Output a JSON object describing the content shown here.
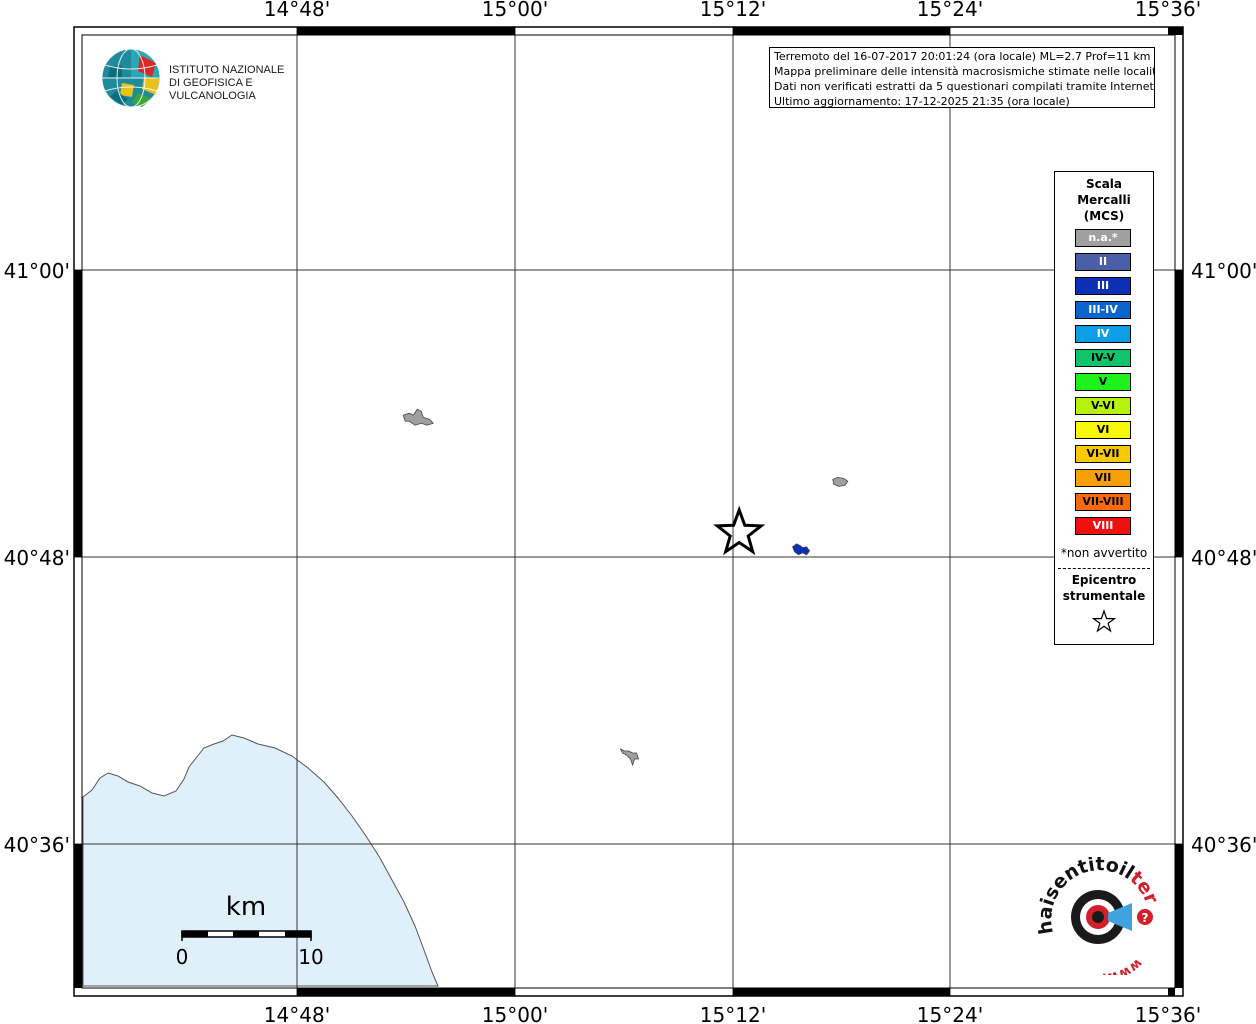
{
  "info": {
    "line1": "Terremoto del 16-07-2017 20:01:24 (ora locale) ML=2.7 Prof=11 km",
    "line2": "Mappa preliminare delle intensità macrosismiche stimate nelle località",
    "line3": "Dati non verificati estratti da 5 questionari compilati tramite Internet.",
    "line4": "Ultimo aggiornamento: 17-12-2025 21:35 (ora locale)"
  },
  "ingv_logo": {
    "line1": "ISTITUTO NAZIONALE",
    "line2": "DI GEOFISICA E VULCANOLOGIA"
  },
  "axes": {
    "lon_labels": [
      "14°48'",
      "15°00'",
      "15°12'",
      "15°24'",
      "15°36'"
    ],
    "lat_labels": [
      "41°00'",
      "40°48'",
      "40°36'"
    ]
  },
  "legend": {
    "title1": "Scala",
    "title2": "Mercalli",
    "title3": "(MCS)",
    "items": [
      {
        "label": "n.a.*",
        "color": "#a0a0a0",
        "text_color": "#ffffff"
      },
      {
        "label": "II",
        "color": "#4a5fa8",
        "text_color": "#ffffff"
      },
      {
        "label": "III",
        "color": "#0b2fb5",
        "text_color": "#ffffff"
      },
      {
        "label": "III-IV",
        "color": "#0a66cc",
        "text_color": "#ffffff"
      },
      {
        "label": "IV",
        "color": "#0e9ee8",
        "text_color": "#ffffff"
      },
      {
        "label": "IV-V",
        "color": "#10c46c",
        "text_color": "#000000"
      },
      {
        "label": "V",
        "color": "#1df21d",
        "text_color": "#000000"
      },
      {
        "label": "V-VI",
        "color": "#b6f20e",
        "text_color": "#000000"
      },
      {
        "label": "VI",
        "color": "#f8f80a",
        "text_color": "#000000"
      },
      {
        "label": "VI-VII",
        "color": "#f8c80a",
        "text_color": "#000000"
      },
      {
        "label": "VII",
        "color": "#f8a00a",
        "text_color": "#000000"
      },
      {
        "label": "VII-VIII",
        "color": "#f86a0a",
        "text_color": "#000000"
      },
      {
        "label": "VIII",
        "color": "#f01010",
        "text_color": "#ffffff"
      }
    ],
    "note": "*non avvertito",
    "epicenter1": "Epicentro",
    "epicenter2": "strumentale"
  },
  "scalebar": {
    "unit": "km",
    "min": "0",
    "max": "10"
  },
  "markers": {
    "epicenter": {
      "lon": 15.2057,
      "lat": 40.8167
    },
    "localities": [
      {
        "intensity": "n.a.*",
        "lon": 14.9103,
        "lat": 40.896,
        "color": "#a0a0a0"
      },
      {
        "intensity": "n.a.*",
        "lon": 15.298,
        "lat": 40.852,
        "color": "#a0a0a0"
      },
      {
        "intensity": "II",
        "lon": 15.262,
        "lat": 40.805,
        "color": "#0b2fb5"
      },
      {
        "intensity": "n.a.*",
        "lon": 15.106,
        "lat": 40.662,
        "color": "#a0a0a0"
      }
    ]
  },
  "colors": {
    "sea": "#dff0fb",
    "grid": "#333333",
    "frame": "#000000"
  },
  "logo_hst": {
    "text1": "haisentitoil",
    "text2": "terremoto.it",
    "text3": "www."
  }
}
